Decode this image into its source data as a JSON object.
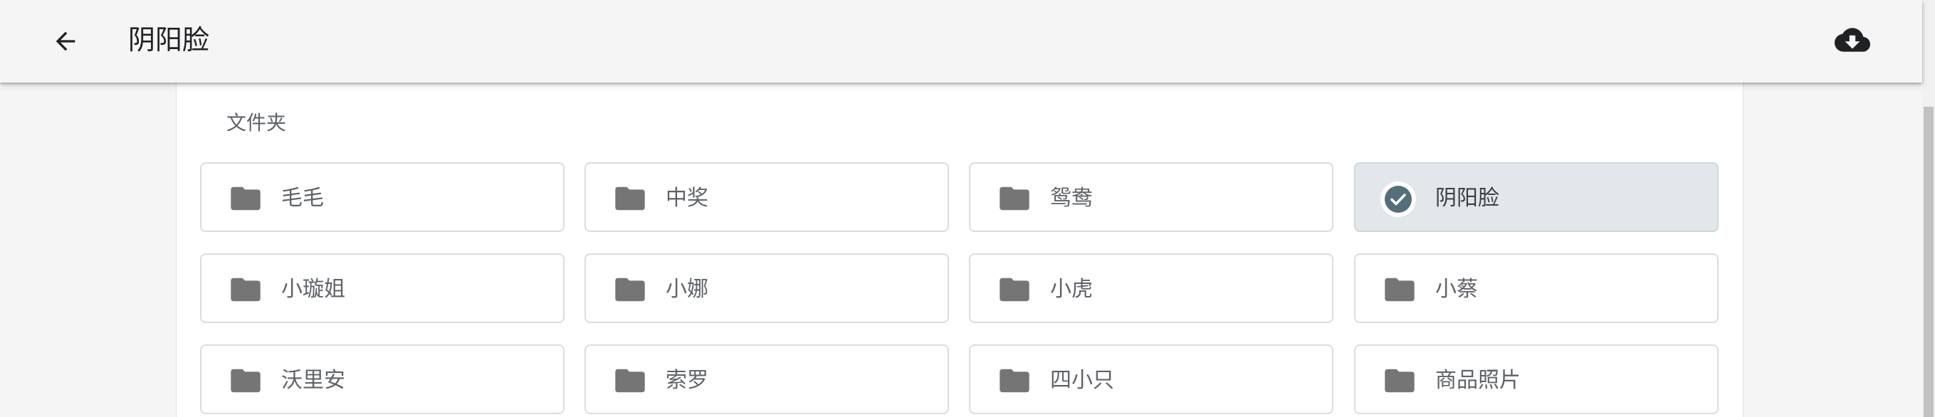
{
  "app_bar": {
    "title": "阴阳脸",
    "back_icon": "arrow-left-icon",
    "download_icon": "cloud-download-icon"
  },
  "section": {
    "title": "文件夹"
  },
  "folders": [
    {
      "label": "毛毛",
      "selected": false
    },
    {
      "label": "中奖",
      "selected": false
    },
    {
      "label": "鸳鸯",
      "selected": false
    },
    {
      "label": "阴阳脸",
      "selected": true
    },
    {
      "label": "小璇姐",
      "selected": false
    },
    {
      "label": "小娜",
      "selected": false
    },
    {
      "label": "小虎",
      "selected": false
    },
    {
      "label": "小蔡",
      "selected": false
    },
    {
      "label": "沃里安",
      "selected": false
    },
    {
      "label": "索罗",
      "selected": false
    },
    {
      "label": "四小只",
      "selected": false
    },
    {
      "label": "商品照片",
      "selected": false
    }
  ],
  "colors": {
    "folder_icon": "#757575",
    "selected_bg": "#e2e7ea",
    "check_circle": "#546e7a"
  }
}
